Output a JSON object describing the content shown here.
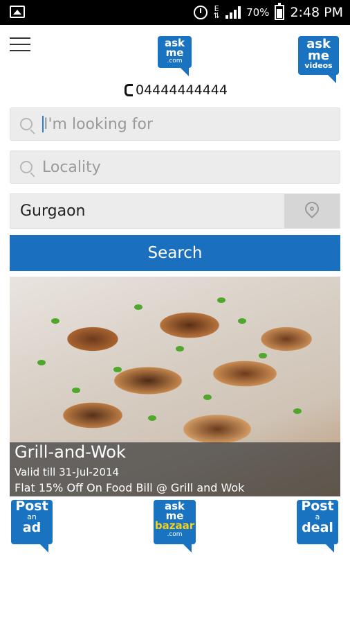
{
  "status_bar": {
    "battery_percent": "70%",
    "time": "2:48 PM",
    "data_indicator": "E",
    "icons": [
      "image-notification-icon",
      "alarm-icon",
      "data-arrows-icon",
      "signal-icon",
      "battery-icon"
    ]
  },
  "header": {
    "logo": {
      "line1": "ask",
      "line2": "me",
      "line3": ".com"
    },
    "videos_logo": {
      "line1": "ask",
      "line2": "me",
      "line3": "videos"
    },
    "phone": "04444444444"
  },
  "search": {
    "what_placeholder": "I'm looking for",
    "locality_placeholder": "Locality",
    "city_value": "Gurgaon",
    "button_label": "Search"
  },
  "deal": {
    "title": "Grill-and-Wok",
    "validity": "Valid till 31-Jul-2014",
    "offer": "Flat 15% Off On Food Bill @ Grill and Wok"
  },
  "actions": {
    "post_ad": {
      "line1": "Post",
      "line2": "an",
      "line3": "ad"
    },
    "bazaar": {
      "line1": "ask",
      "line2": "me",
      "line3": "bazaar",
      "line4": ".com"
    },
    "post_deal": {
      "line1": "Post",
      "line2": "a",
      "line3": "deal"
    }
  },
  "colors": {
    "brand_blue": "#1a6fbf",
    "bazaar_yellow": "#f6d11a",
    "status_bar": "#000000"
  }
}
